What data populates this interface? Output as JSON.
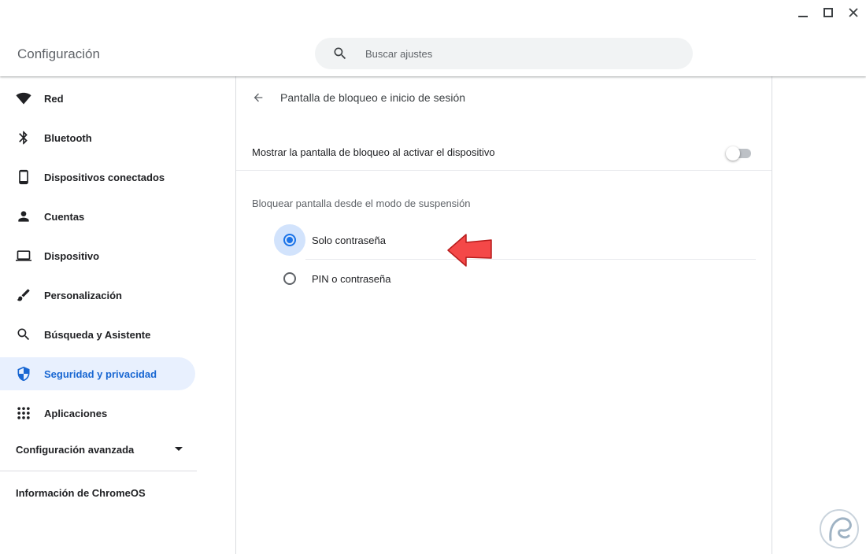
{
  "window": {
    "minimize_icon": "minimize-icon",
    "maximize_icon": "maximize-icon",
    "close_icon": "close-icon"
  },
  "header": {
    "title": "Configuración",
    "search": {
      "placeholder": "Buscar ajustes",
      "value": "",
      "icon": "search-icon"
    }
  },
  "sidebar": {
    "items": [
      {
        "label": "Red",
        "icon": "wifi-icon",
        "active": false
      },
      {
        "label": "Bluetooth",
        "icon": "bluetooth-icon",
        "active": false
      },
      {
        "label": "Dispositivos conectados",
        "icon": "phone-icon",
        "active": false
      },
      {
        "label": "Cuentas",
        "icon": "person-icon",
        "active": false
      },
      {
        "label": "Dispositivo",
        "icon": "laptop-icon",
        "active": false
      },
      {
        "label": "Personalización",
        "icon": "brush-icon",
        "active": false
      },
      {
        "label": "Búsqueda y Asistente",
        "icon": "search-icon",
        "active": false
      },
      {
        "label": "Seguridad y privacidad",
        "icon": "shield-icon",
        "active": true
      },
      {
        "label": "Aplicaciones",
        "icon": "apps-grid-icon",
        "active": false
      }
    ],
    "advanced_label": "Configuración avanzada",
    "about_label": "Información de ChromeOS"
  },
  "main": {
    "subpage_title": "Pantalla de bloqueo e inicio de sesión",
    "lock_on_wake_label": "Mostrar la pantalla de bloqueo al activar el dispositivo",
    "lock_on_wake_enabled": false,
    "sleep_section_heading": "Bloquear pantalla desde el modo de suspensión",
    "options": [
      {
        "label": "Solo contraseña",
        "selected": true
      },
      {
        "label": "PIN o contraseña",
        "selected": false
      }
    ]
  },
  "colors": {
    "accent": "#1a73e8",
    "active_nav_bg": "#e8f0fe",
    "active_nav_text": "#1967d2",
    "annotation_arrow": "#f44848"
  }
}
